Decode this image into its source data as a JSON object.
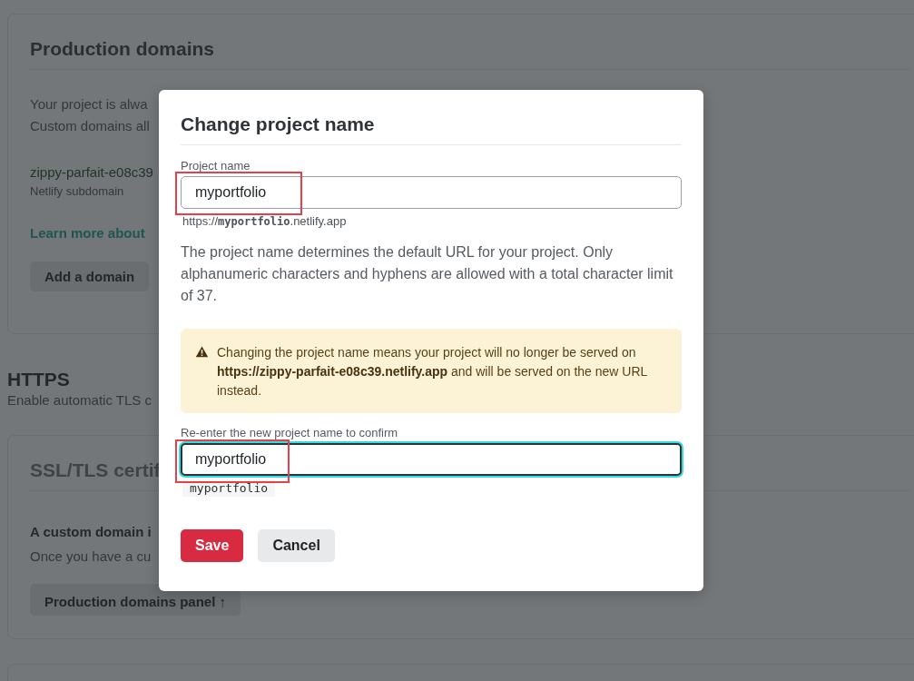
{
  "background": {
    "production_domains": {
      "title": "Production domains",
      "description": [
        "Your project is alwa",
        "Custom domains all"
      ],
      "subdomain": {
        "name": "zippy-parfait-e08c39",
        "label": "Netlify subdomain"
      },
      "learn_more_link": "Learn more about",
      "add_domain_button": "Add a domain"
    },
    "https": {
      "title": "HTTPS",
      "description": "Enable automatic TLS c",
      "card": {
        "title": "SSL/TLS certif",
        "subtitle": "A custom domain i",
        "text": "Once you have a cu",
        "button": "Production domains panel ↑"
      }
    }
  },
  "dialog": {
    "title": "Change project name",
    "project_name": {
      "label": "Project name",
      "value": "myportfolio",
      "url_prefix": "https://",
      "url_name": "myportfolio",
      "url_suffix": ".netlify.app"
    },
    "help": "The project name determines the default URL for your project. Only alphanumeric characters and hyphens are allowed with a total character limit of 37.",
    "warning": "Changing the project name means your project will no longer be served on **https://zippy-parfait-e08c39.netlify.app** and will be served on the new URL instead.",
    "confirm": {
      "label": "Re-enter the new project name to confirm",
      "value": "myportfolio",
      "focused": true,
      "hint": "myportfolio"
    },
    "buttons": [
      {
        "label": "Save",
        "kind": "primary"
      },
      {
        "label": "Cancel",
        "kind": "secondary"
      }
    ]
  }
}
